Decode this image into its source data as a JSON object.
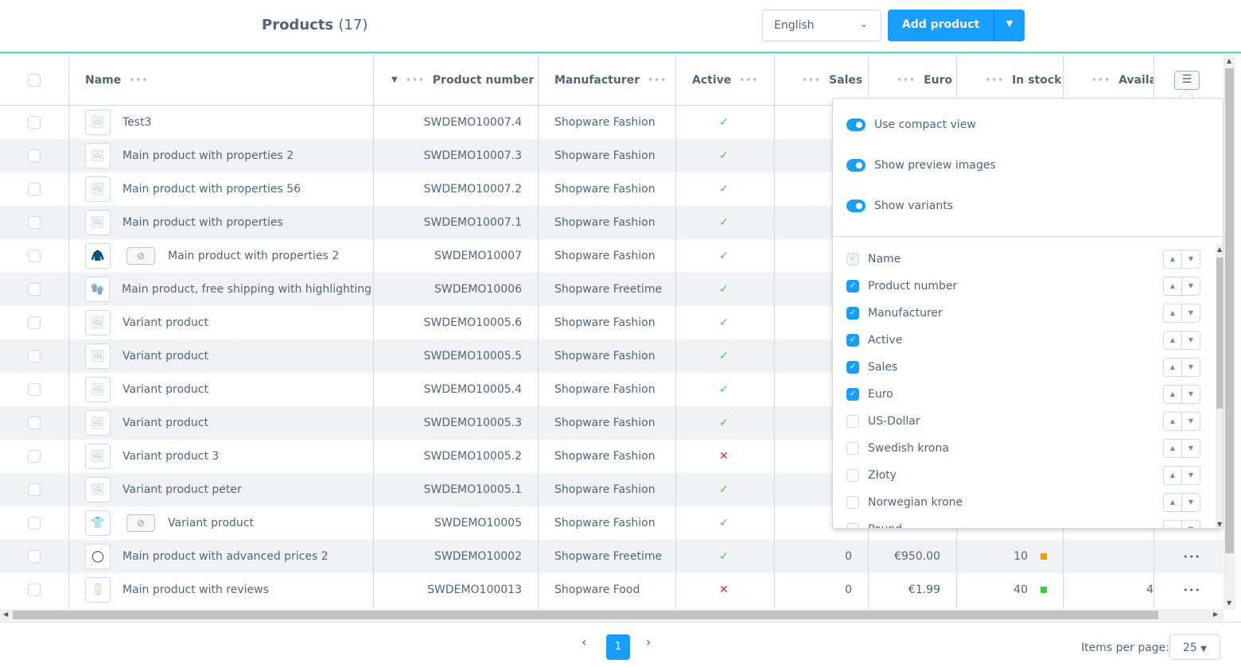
{
  "header": {
    "title": "Products",
    "count": "(17)",
    "language": "English",
    "add_product": "Add product"
  },
  "columns": {
    "name": "Name",
    "product_number": "Product number",
    "manufacturer": "Manufacturer",
    "active": "Active",
    "sales": "Sales",
    "euro": "Euro",
    "in_stock": "In stock",
    "available": "Availabl"
  },
  "rows": [
    {
      "name": "Test3",
      "number": "SWDEMO10007.4",
      "manufacturer": "Shopware Fashion",
      "active": true,
      "thumb": "placeholder"
    },
    {
      "name": "Main product with properties 2",
      "number": "SWDEMO10007.3",
      "manufacturer": "Shopware Fashion",
      "active": true,
      "thumb": "placeholder"
    },
    {
      "name": "Main product with properties 56",
      "number": "SWDEMO10007.2",
      "manufacturer": "Shopware Fashion",
      "active": true,
      "thumb": "placeholder"
    },
    {
      "name": "Main product with properties",
      "number": "SWDEMO10007.1",
      "manufacturer": "Shopware Fashion",
      "active": true,
      "thumb": "placeholder"
    },
    {
      "name": "Main product with properties 2",
      "number": "SWDEMO10007",
      "manufacturer": "Shopware Fashion",
      "active": true,
      "thumb": "jacket",
      "variants": true
    },
    {
      "name": "Main product, free shipping with highlighting",
      "number": "SWDEMO10006",
      "manufacturer": "Shopware Freetime",
      "active": true,
      "thumb": "gloves"
    },
    {
      "name": "Variant product",
      "number": "SWDEMO10005.6",
      "manufacturer": "Shopware Fashion",
      "active": true,
      "thumb": "placeholder"
    },
    {
      "name": "Variant product",
      "number": "SWDEMO10005.5",
      "manufacturer": "Shopware Fashion",
      "active": true,
      "thumb": "placeholder"
    },
    {
      "name": "Variant product",
      "number": "SWDEMO10005.4",
      "manufacturer": "Shopware Fashion",
      "active": true,
      "thumb": "placeholder"
    },
    {
      "name": "Variant product",
      "number": "SWDEMO10005.3",
      "manufacturer": "Shopware Fashion",
      "active": true,
      "thumb": "placeholder"
    },
    {
      "name": "Variant product 3",
      "number": "SWDEMO10005.2",
      "manufacturer": "Shopware Fashion",
      "active": false,
      "thumb": "placeholder"
    },
    {
      "name": "Variant product peter",
      "number": "SWDEMO10005.1",
      "manufacturer": "Shopware Fashion",
      "active": true,
      "thumb": "placeholder"
    },
    {
      "name": "Variant product",
      "number": "SWDEMO10005",
      "manufacturer": "Shopware Fashion",
      "active": true,
      "thumb": "shirt",
      "variants": true
    },
    {
      "name": "Main product with advanced prices 2",
      "number": "SWDEMO10002",
      "manufacturer": "Shopware Freetime",
      "active": true,
      "thumb": "washer",
      "sales": "0",
      "euro": "€950.00",
      "stock": "10",
      "stock_color": "#ff9800"
    },
    {
      "name": "Main product with reviews",
      "number": "SWDEMO100013",
      "manufacturer": "Shopware Food",
      "active": false,
      "thumb": "bottle",
      "sales": "0",
      "euro": "€1.99",
      "stock": "40",
      "stock_color": "#37d046",
      "available": "4"
    }
  ],
  "settings": {
    "toggles": [
      {
        "label": "Use compact view",
        "on": true
      },
      {
        "label": "Show preview images",
        "on": true
      },
      {
        "label": "Show variants",
        "on": true
      }
    ],
    "columns": [
      {
        "label": "Name",
        "checked": true,
        "disabled": true
      },
      {
        "label": "Product number",
        "checked": true
      },
      {
        "label": "Manufacturer",
        "checked": true
      },
      {
        "label": "Active",
        "checked": true
      },
      {
        "label": "Sales",
        "checked": true
      },
      {
        "label": "Euro",
        "checked": true
      },
      {
        "label": "US-Dollar",
        "checked": false
      },
      {
        "label": "Swedish krona",
        "checked": false
      },
      {
        "label": "Złoty",
        "checked": false
      },
      {
        "label": "Norwegian krone",
        "checked": false
      },
      {
        "label": "Pound",
        "checked": false
      }
    ]
  },
  "pagination": {
    "current": "1",
    "items_per_page_label": "Items per page:",
    "items_per_page": "25"
  },
  "colors": {
    "accent": "#189eff",
    "header_line": "#57d9a3",
    "active_ok": "#37d046",
    "inactive": "#de294c"
  }
}
